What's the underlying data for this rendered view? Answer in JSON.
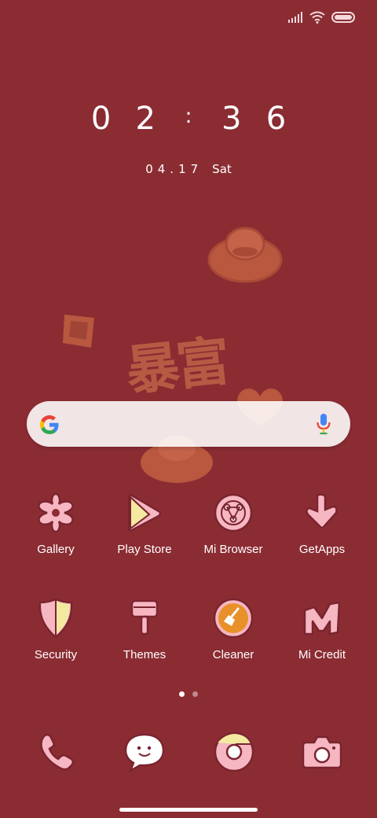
{
  "status_bar": {
    "icons": [
      "signal-icon",
      "wifi-icon",
      "battery-icon"
    ],
    "battery_level": 1.0
  },
  "clock": {
    "h1": "0",
    "h2": "2",
    "colon": ":",
    "m1": "3",
    "m2": "6"
  },
  "date": {
    "day": "04.17",
    "weekday": "Sat"
  },
  "wallpaper": {
    "text": "暴富"
  },
  "search": {
    "icons": [
      "google-g-icon",
      "microphone-icon"
    ]
  },
  "apps": [
    {
      "label": "Gallery",
      "icon": "flower-icon"
    },
    {
      "label": "Play Store",
      "icon": "play-store-icon"
    },
    {
      "label": "Mi Browser",
      "icon": "browser-icon"
    },
    {
      "label": "GetApps",
      "icon": "download-arrow-icon"
    },
    {
      "label": "Security",
      "icon": "shield-icon"
    },
    {
      "label": "Themes",
      "icon": "paint-brush-icon"
    },
    {
      "label": "Cleaner",
      "icon": "broom-icon"
    },
    {
      "label": "Mi Credit",
      "icon": "credit-icon"
    }
  ],
  "page_indicator": {
    "pages": 2,
    "current": 1
  },
  "dock": [
    {
      "icon": "phone-icon"
    },
    {
      "icon": "messaging-icon"
    },
    {
      "icon": "chrome-icon"
    },
    {
      "icon": "camera-icon"
    }
  ],
  "colors": {
    "wallpaper": "#8b2c33",
    "icon_pink": "#f6b7c2",
    "icon_outline": "#7a2430",
    "deco": "#c4624a"
  }
}
